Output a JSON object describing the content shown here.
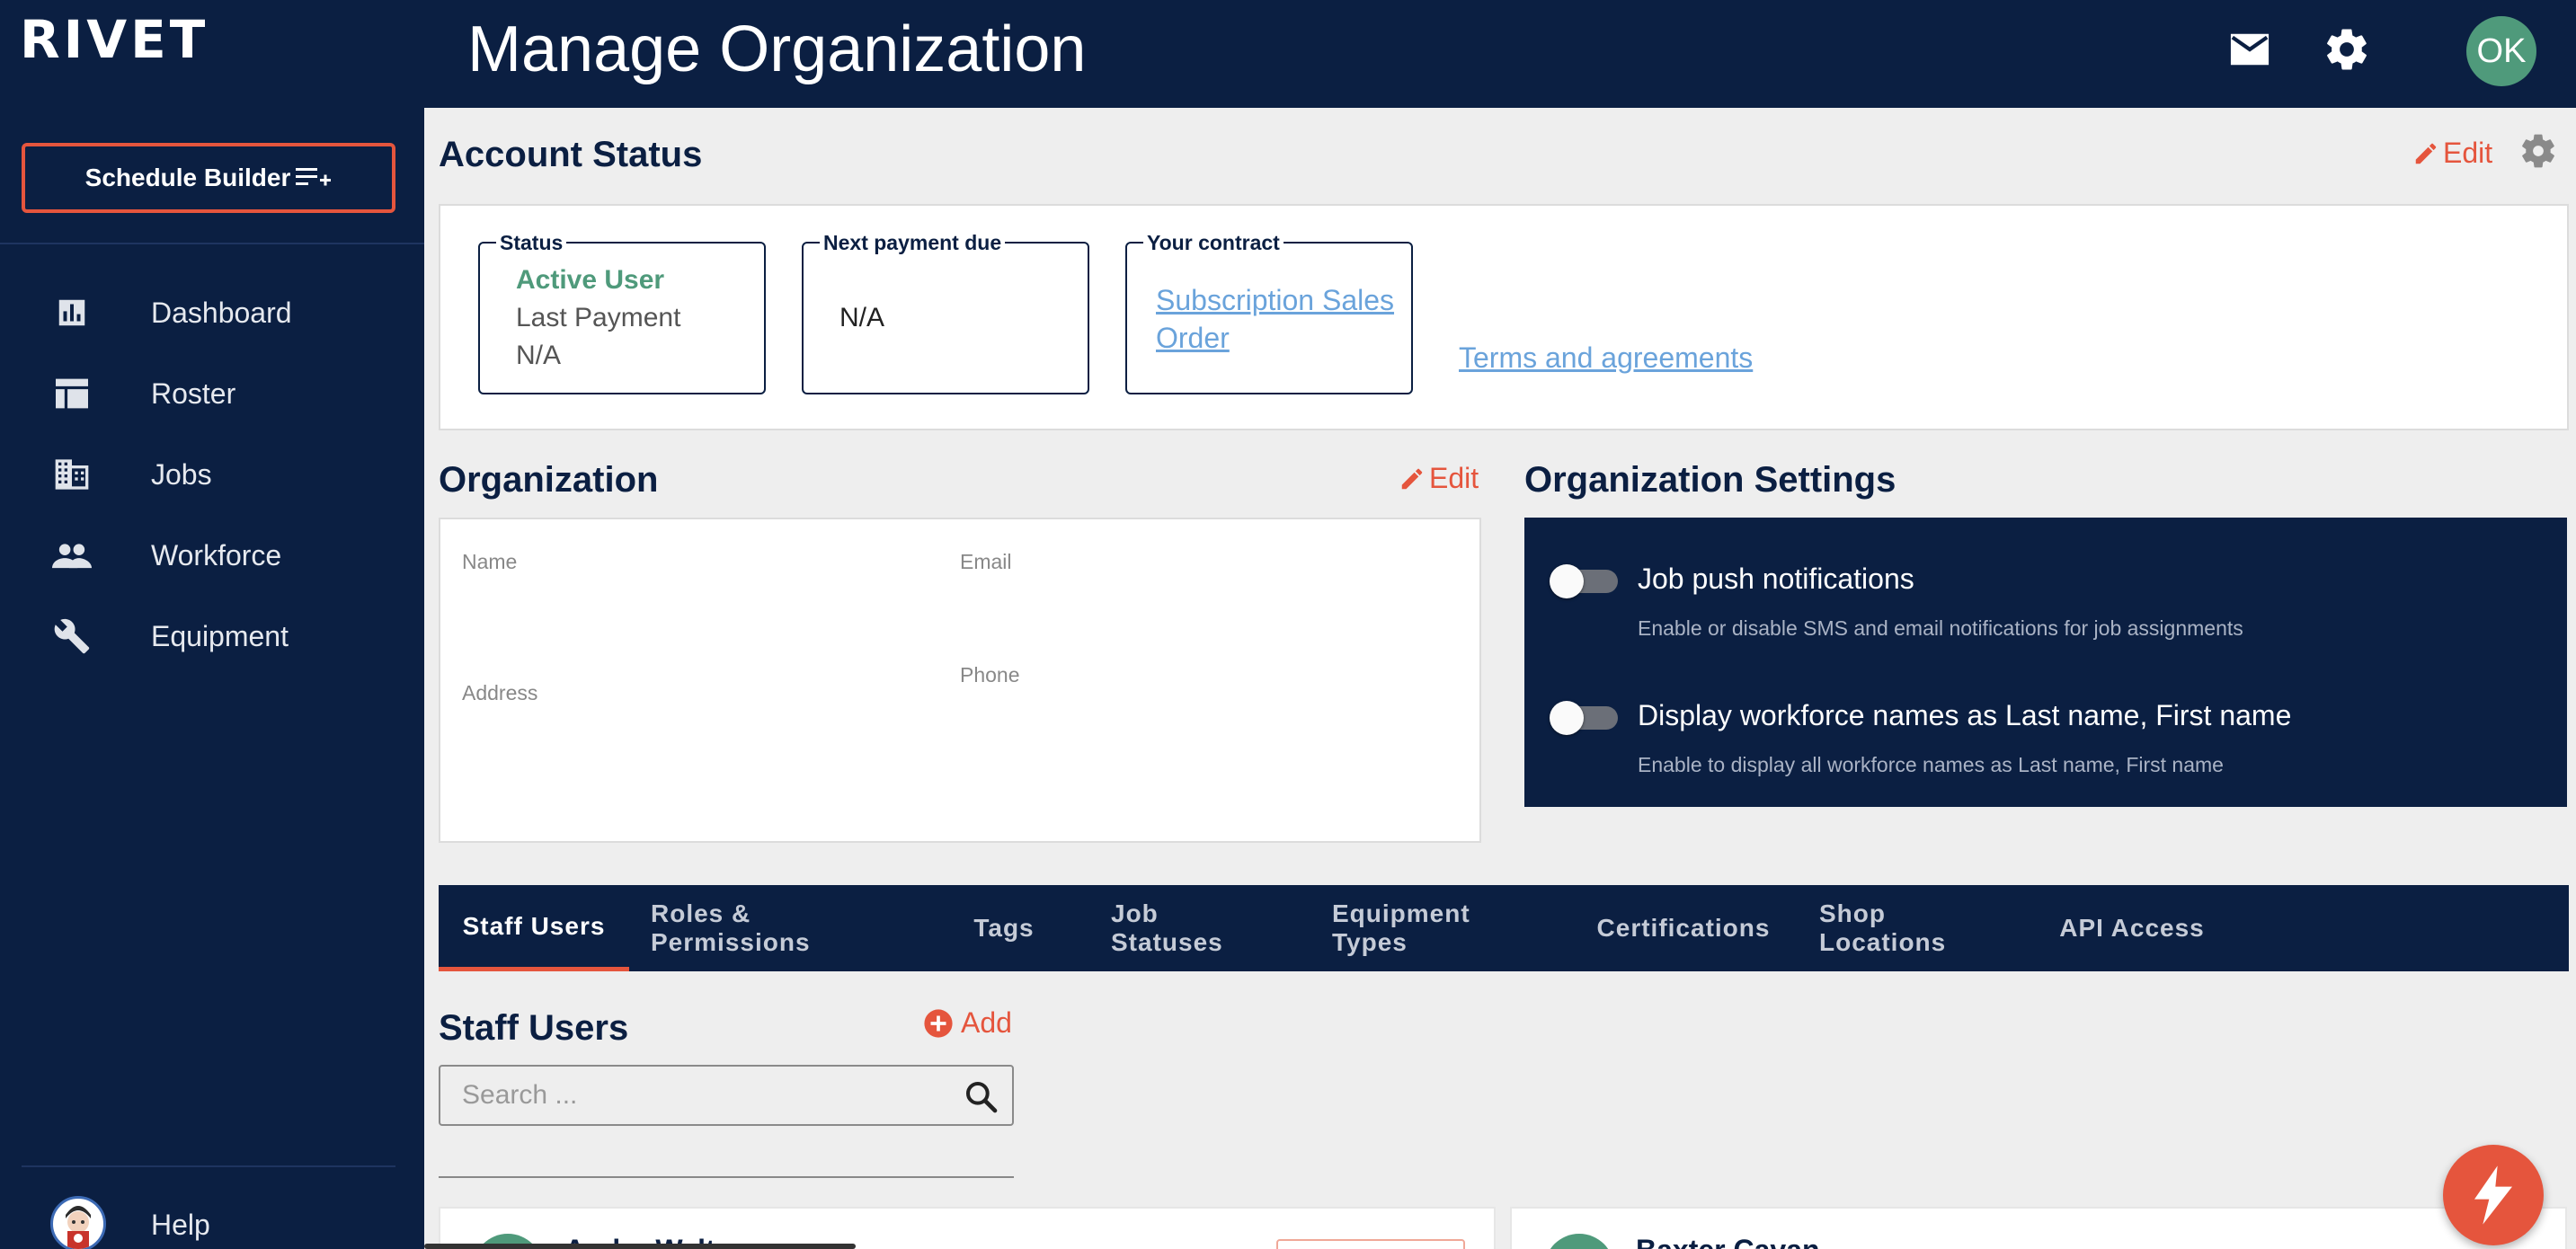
{
  "app": {
    "logo": "RIVET"
  },
  "sidebar": {
    "schedule_builder": "Schedule Builder",
    "items": [
      {
        "label": "Dashboard",
        "icon": "bar-chart-icon"
      },
      {
        "label": "Roster",
        "icon": "table-icon"
      },
      {
        "label": "Jobs",
        "icon": "building-icon"
      },
      {
        "label": "Workforce",
        "icon": "people-icon"
      },
      {
        "label": "Equipment",
        "icon": "wrench-icon"
      }
    ],
    "help": "Help"
  },
  "header": {
    "title": "Manage Organization",
    "avatar_initials": "OK"
  },
  "account_status": {
    "title": "Account Status",
    "edit": "Edit",
    "status_legend": "Status",
    "status_value": "Active User",
    "last_payment_label": "Last Payment",
    "last_payment_value": "N/A",
    "next_payment_legend": "Next payment due",
    "next_payment_value": "N/A",
    "contract_legend": "Your contract",
    "contract_link_1": "Subscription Sales",
    "contract_link_2": "Order",
    "terms_link": "Terms and agreements"
  },
  "organization": {
    "title": "Organization",
    "edit": "Edit",
    "name_label": "Name",
    "email_label": "Email",
    "address_label": "Address",
    "phone_label": "Phone"
  },
  "org_settings": {
    "title": "Organization Settings",
    "settings": [
      {
        "title": "Job push notifications",
        "desc": "Enable or disable SMS and email notifications for job assignments",
        "enabled": false
      },
      {
        "title": "Display workforce names as Last name, First name",
        "desc": "Enable to display all workforce names as Last name, First name",
        "enabled": false
      }
    ]
  },
  "tabs": [
    {
      "label": "Staff Users",
      "active": true
    },
    {
      "label": "Roles & Permissions",
      "active": false
    },
    {
      "label": "Tags",
      "active": false
    },
    {
      "label": "Job Statuses",
      "active": false
    },
    {
      "label": "Equipment Types",
      "active": false
    },
    {
      "label": "Certifications",
      "active": false
    },
    {
      "label": "Shop Locations",
      "active": false
    },
    {
      "label": "API Access",
      "active": false
    }
  ],
  "staff_users": {
    "title": "Staff Users",
    "add": "Add",
    "search_placeholder": "Search ...",
    "users": [
      {
        "name": "Andre Walt"
      },
      {
        "name": "Baxter Cavan"
      }
    ]
  },
  "colors": {
    "navy": "#0b1f42",
    "accent": "#e5553d",
    "success": "#4f9a7b",
    "link": "#6aa3db"
  }
}
